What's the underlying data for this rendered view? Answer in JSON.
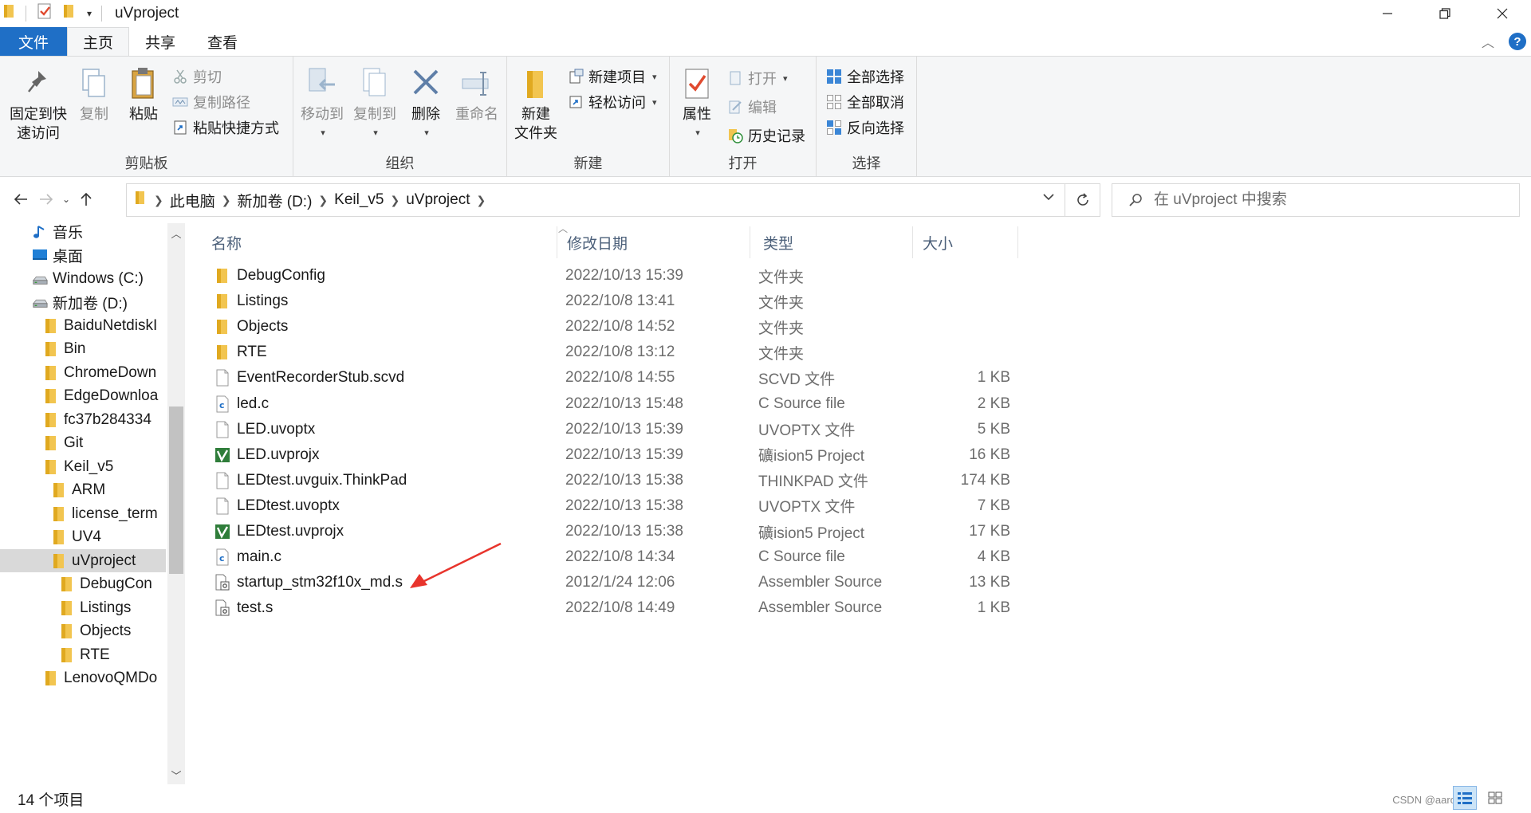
{
  "window": {
    "title": "uVproject",
    "controls": [
      "minimize",
      "restore",
      "close"
    ]
  },
  "ribbon_tabs": {
    "file": "文件",
    "home": "主页",
    "share": "共享",
    "view": "查看",
    "active": "主页"
  },
  "ribbon": {
    "clipboard": {
      "label": "剪贴板",
      "pin_line1": "固定到快",
      "pin_line2": "速访问",
      "copy": "复制",
      "paste": "粘贴",
      "cut": "剪切",
      "copy_path": "复制路径",
      "paste_shortcut": "粘贴快捷方式"
    },
    "organize": {
      "label": "组织",
      "move_to": "移动到",
      "copy_to": "复制到",
      "delete": "删除",
      "rename": "重命名"
    },
    "new": {
      "label": "新建",
      "new_folder_line1": "新建",
      "new_folder_line2": "文件夹",
      "new_item": "新建项目",
      "easy_access": "轻松访问"
    },
    "open": {
      "label": "打开",
      "properties": "属性",
      "open": "打开",
      "edit": "编辑",
      "history": "历史记录"
    },
    "select": {
      "label": "选择",
      "select_all": "全部选择",
      "select_none": "全部取消",
      "invert": "反向选择"
    }
  },
  "address": {
    "crumbs": [
      "此电脑",
      "新加卷 (D:)",
      "Keil_v5",
      "uVproject"
    ],
    "search_placeholder": "在 uVproject 中搜索"
  },
  "nav_tree": [
    {
      "label": "音乐",
      "icon": "music-icon",
      "indent": 0
    },
    {
      "label": "桌面",
      "icon": "desktop-icon",
      "indent": 0
    },
    {
      "label": "Windows (C:)",
      "icon": "drive-icon",
      "indent": 0
    },
    {
      "label": "新加卷 (D:)",
      "icon": "drive-icon",
      "indent": 0
    },
    {
      "label": "BaiduNetdiskI",
      "icon": "folder-icon",
      "indent": 1
    },
    {
      "label": "Bin",
      "icon": "folder-icon",
      "indent": 1
    },
    {
      "label": "ChromeDown",
      "icon": "folder-icon",
      "indent": 1
    },
    {
      "label": "EdgeDownloa",
      "icon": "folder-icon",
      "indent": 1
    },
    {
      "label": "fc37b284334",
      "icon": "folder-icon",
      "indent": 1
    },
    {
      "label": "Git",
      "icon": "folder-icon",
      "indent": 1
    },
    {
      "label": "Keil_v5",
      "icon": "folder-icon",
      "indent": 1
    },
    {
      "label": "ARM",
      "icon": "folder-icon",
      "indent": 2
    },
    {
      "label": "license_term",
      "icon": "folder-icon",
      "indent": 2
    },
    {
      "label": "UV4",
      "icon": "folder-icon",
      "indent": 2
    },
    {
      "label": "uVproject",
      "icon": "folder-icon",
      "indent": 2,
      "selected": true
    },
    {
      "label": "DebugCon",
      "icon": "folder-icon",
      "indent": 3
    },
    {
      "label": "Listings",
      "icon": "folder-icon",
      "indent": 3
    },
    {
      "label": "Objects",
      "icon": "folder-icon",
      "indent": 3
    },
    {
      "label": "RTE",
      "icon": "folder-icon",
      "indent": 3
    },
    {
      "label": "LenovoQMDo",
      "icon": "folder-icon",
      "indent": 1
    }
  ],
  "columns": {
    "name": "名称",
    "date": "修改日期",
    "type": "类型",
    "size": "大小"
  },
  "files": [
    {
      "name": "DebugConfig",
      "date": "2022/10/13 15:39",
      "type": "文件夹",
      "size": "",
      "icon": "folder-icon"
    },
    {
      "name": "Listings",
      "date": "2022/10/8 13:41",
      "type": "文件夹",
      "size": "",
      "icon": "folder-icon"
    },
    {
      "name": "Objects",
      "date": "2022/10/8 14:52",
      "type": "文件夹",
      "size": "",
      "icon": "folder-icon"
    },
    {
      "name": "RTE",
      "date": "2022/10/8 13:12",
      "type": "文件夹",
      "size": "",
      "icon": "folder-icon"
    },
    {
      "name": "EventRecorderStub.scvd",
      "date": "2022/10/8 14:55",
      "type": "SCVD 文件",
      "size": "1 KB",
      "icon": "file-icon"
    },
    {
      "name": "led.c",
      "date": "2022/10/13 15:48",
      "type": "C Source file",
      "size": "2 KB",
      "icon": "c-file-icon"
    },
    {
      "name": "LED.uvoptx",
      "date": "2022/10/13 15:39",
      "type": "UVOPTX 文件",
      "size": "5 KB",
      "icon": "file-icon"
    },
    {
      "name": "LED.uvprojx",
      "date": "2022/10/13 15:39",
      "type": "礦ision5 Project",
      "size": "16 KB",
      "icon": "uvision-icon"
    },
    {
      "name": "LEDtest.uvguix.ThinkPad",
      "date": "2022/10/13 15:38",
      "type": "THINKPAD 文件",
      "size": "174 KB",
      "icon": "file-icon"
    },
    {
      "name": "LEDtest.uvoptx",
      "date": "2022/10/13 15:38",
      "type": "UVOPTX 文件",
      "size": "7 KB",
      "icon": "file-icon"
    },
    {
      "name": "LEDtest.uvprojx",
      "date": "2022/10/13 15:38",
      "type": "礦ision5 Project",
      "size": "17 KB",
      "icon": "uvision-icon"
    },
    {
      "name": "main.c",
      "date": "2022/10/8 14:34",
      "type": "C Source file",
      "size": "4 KB",
      "icon": "c-file-icon"
    },
    {
      "name": "startup_stm32f10x_md.s",
      "date": "2012/1/24 12:06",
      "type": "Assembler Source",
      "size": "13 KB",
      "icon": "asm-file-icon"
    },
    {
      "name": "test.s",
      "date": "2022/10/8 14:49",
      "type": "Assembler Source",
      "size": "1 KB",
      "icon": "asm-file-icon"
    }
  ],
  "status": {
    "count": "14 个项目",
    "watermark": "CSDN @aaron.h"
  },
  "colors": {
    "accent": "#1f6fc6",
    "folder": "#f2c550",
    "annotation_arrow": "#e8342c",
    "selected_bg": "#d9d9d9"
  }
}
